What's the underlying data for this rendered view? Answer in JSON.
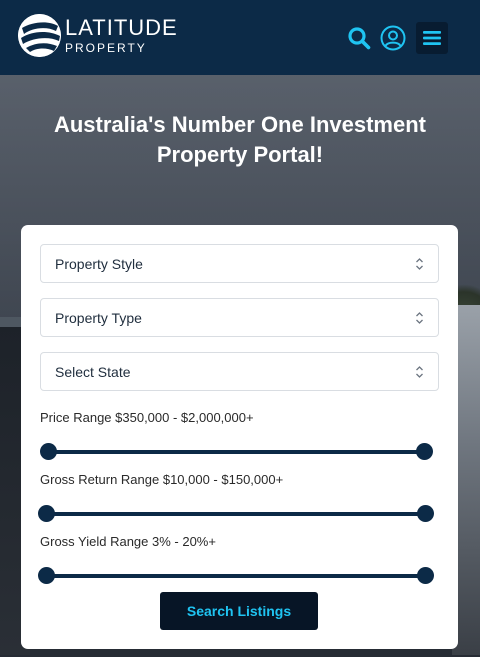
{
  "header": {
    "brand": "LATITUDE",
    "sub": "PROPERTY",
    "icons": {
      "search": "search-icon",
      "user": "user-icon",
      "menu": "menu-icon"
    },
    "colors": {
      "bar": "#0c2a47",
      "accent": "#1fc4f2"
    }
  },
  "hero": {
    "title": "Australia's Number One Investment Property Portal!"
  },
  "search": {
    "property_style": "Property Style",
    "property_type": "Property Type",
    "state": "Select State",
    "price_label": "Price Range $350,000 - $2,000,000+",
    "gross_return_label": "Gross Return Range $10,000 - $150,000+",
    "yield_label": "Gross Yield Range 3% - 20%+",
    "submit_label": "Search Listings"
  }
}
